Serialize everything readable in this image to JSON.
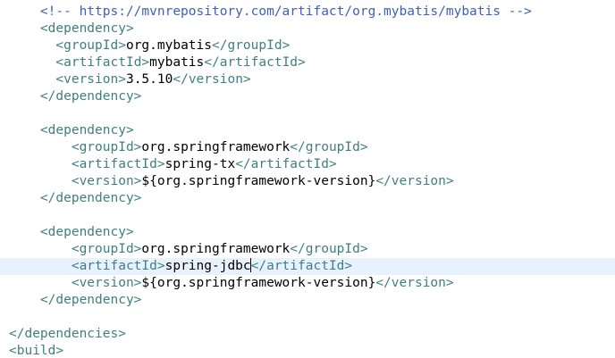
{
  "editor": {
    "current_line_index": 16,
    "caret_line_index": 16,
    "lines": [
      {
        "indent": "    ",
        "tokens": [
          {
            "t": "comment",
            "v": "<!-- https://mvnrepository.com/artifact/org.mybatis/mybatis -->"
          }
        ]
      },
      {
        "indent": "    ",
        "tokens": [
          {
            "t": "tag",
            "v": "<dependency>"
          }
        ]
      },
      {
        "indent": "      ",
        "tokens": [
          {
            "t": "tag",
            "v": "<groupId>"
          },
          {
            "t": "text",
            "v": "org.mybatis"
          },
          {
            "t": "tag",
            "v": "</groupId>"
          }
        ]
      },
      {
        "indent": "      ",
        "tokens": [
          {
            "t": "tag",
            "v": "<artifactId>"
          },
          {
            "t": "text",
            "v": "mybatis"
          },
          {
            "t": "tag",
            "v": "</artifactId>"
          }
        ]
      },
      {
        "indent": "      ",
        "tokens": [
          {
            "t": "tag",
            "v": "<version>"
          },
          {
            "t": "text",
            "v": "3.5.10"
          },
          {
            "t": "tag",
            "v": "</version>"
          }
        ]
      },
      {
        "indent": "    ",
        "tokens": [
          {
            "t": "tag",
            "v": "</dependency>"
          }
        ]
      },
      {
        "indent": "",
        "tokens": []
      },
      {
        "indent": "    ",
        "tokens": [
          {
            "t": "tag",
            "v": "<dependency>"
          }
        ]
      },
      {
        "indent": "        ",
        "tokens": [
          {
            "t": "tag",
            "v": "<groupId>"
          },
          {
            "t": "text",
            "v": "org.springframework"
          },
          {
            "t": "tag",
            "v": "</groupId>"
          }
        ]
      },
      {
        "indent": "        ",
        "tokens": [
          {
            "t": "tag",
            "v": "<artifactId>"
          },
          {
            "t": "text",
            "v": "spring-tx"
          },
          {
            "t": "tag",
            "v": "</artifactId>"
          }
        ]
      },
      {
        "indent": "        ",
        "tokens": [
          {
            "t": "tag",
            "v": "<version>"
          },
          {
            "t": "text",
            "v": "${org.springframework-version}"
          },
          {
            "t": "tag",
            "v": "</version>"
          }
        ]
      },
      {
        "indent": "    ",
        "tokens": [
          {
            "t": "tag",
            "v": "</dependency>"
          }
        ]
      },
      {
        "indent": "",
        "tokens": []
      },
      {
        "indent": "    ",
        "tokens": [
          {
            "t": "tag",
            "v": "<dependency>"
          }
        ]
      },
      {
        "indent": "        ",
        "tokens": [
          {
            "t": "tag",
            "v": "<groupId>"
          },
          {
            "t": "text",
            "v": "org.springframework"
          },
          {
            "t": "tag",
            "v": "</groupId>"
          }
        ]
      },
      {
        "indent": "        ",
        "tokens": [
          {
            "t": "tag",
            "v": "<artifactId>"
          },
          {
            "t": "text",
            "v": "spring-jdbc"
          },
          {
            "t": "caret",
            "v": ""
          },
          {
            "t": "tag",
            "v": "</artifactId>"
          }
        ]
      },
      {
        "indent": "        ",
        "tokens": [
          {
            "t": "tag",
            "v": "<version>"
          },
          {
            "t": "text",
            "v": "${org.springframework-version}"
          },
          {
            "t": "tag",
            "v": "</version>"
          }
        ]
      },
      {
        "indent": "    ",
        "tokens": [
          {
            "t": "tag",
            "v": "</dependency>"
          }
        ]
      },
      {
        "indent": "",
        "tokens": []
      },
      {
        "indent": "",
        "tokens": [
          {
            "t": "tag",
            "v": "</dependencies>"
          }
        ]
      },
      {
        "indent": "",
        "tokens": [
          {
            "t": "tag",
            "v": "<build>"
          }
        ]
      }
    ]
  },
  "colors": {
    "comment": "#3f5fbf",
    "tag": "#3f7f7f",
    "text": "#000000",
    "current_line": "#e8f2fe"
  }
}
